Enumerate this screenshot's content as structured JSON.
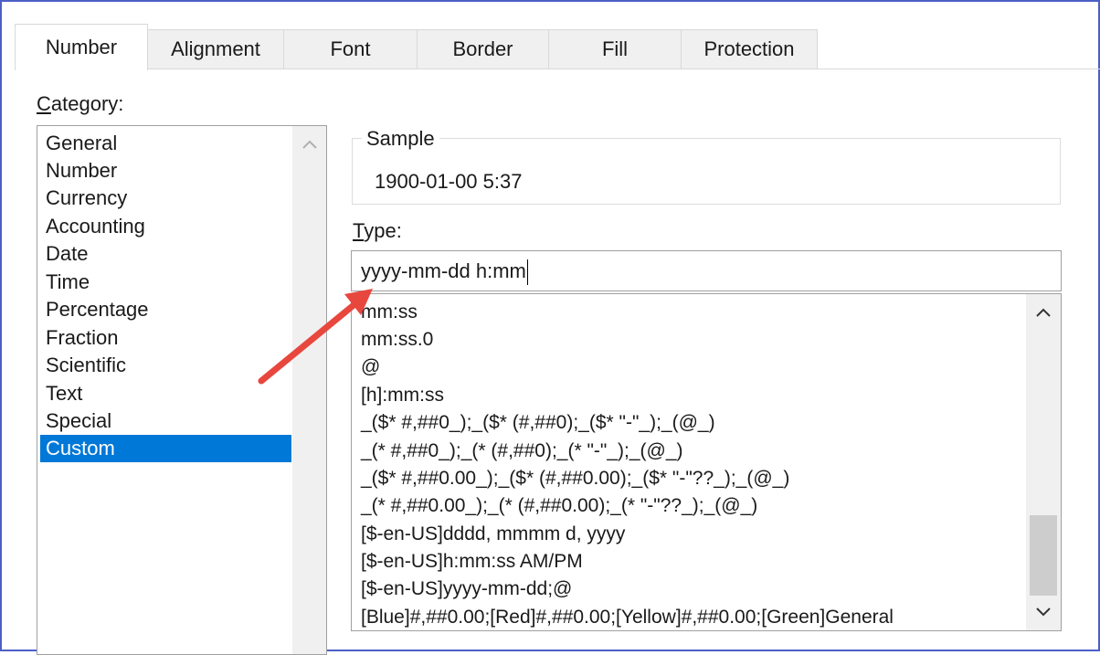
{
  "tabs": [
    "Number",
    "Alignment",
    "Font",
    "Border",
    "Fill",
    "Protection"
  ],
  "active_tab": "Number",
  "category": {
    "label_underlined": "C",
    "label_rest": "ategory:",
    "items": [
      "General",
      "Number",
      "Currency",
      "Accounting",
      "Date",
      "Time",
      "Percentage",
      "Fraction",
      "Scientific",
      "Text",
      "Special",
      "Custom"
    ],
    "selected": "Custom"
  },
  "sample": {
    "legend": "Sample",
    "value": "1900-01-00 5:37"
  },
  "type": {
    "label_underlined": "T",
    "label_rest": "ype:",
    "value": "yyyy-mm-dd h:mm",
    "list": [
      "mm:ss",
      "mm:ss.0",
      "@",
      "[h]:mm:ss",
      "_($* #,##0_);_($* (#,##0);_($* \"-\"_);_(@_)",
      "_(* #,##0_);_(* (#,##0);_(* \"-\"_);_(@_)",
      "_($* #,##0.00_);_($* (#,##0.00);_($* \"-\"??_);_(@_)",
      "_(* #,##0.00_);_(* (#,##0.00);_(* \"-\"??_);_(@_)",
      "[$-en-US]dddd, mmmm d, yyyy",
      "[$-en-US]h:mm:ss AM/PM",
      "[$-en-US]yyyy-mm-dd;@",
      "[Blue]#,##0.00;[Red]#,##0.00;[Yellow]#,##0.00;[Green]General"
    ]
  },
  "icons": {
    "scroll_up": "chevron-up-icon",
    "scroll_down": "chevron-down-icon",
    "annotation": "red-arrow"
  },
  "colors": {
    "selection": "#0078d7",
    "arrow": "#e8473e",
    "frame": "#4c5fc7"
  }
}
